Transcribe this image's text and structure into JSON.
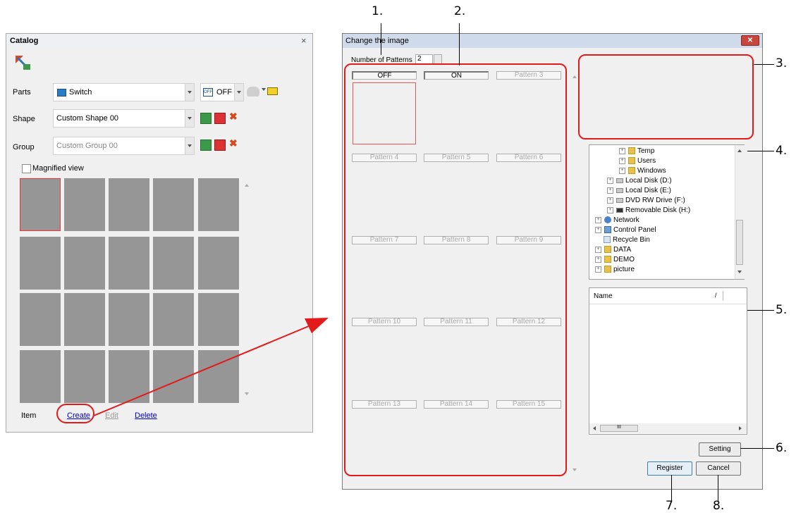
{
  "catalog": {
    "title": "Catalog",
    "close": "×",
    "parts_label": "Parts",
    "parts_value": "Switch",
    "state_value": "OFF",
    "state_badge": "OFF",
    "shape_label": "Shape",
    "shape_value": "Custom Shape 00",
    "group_label": "Group",
    "group_value": "Custom Group 00",
    "magnified_label": "Magnified view",
    "item_label": "Item",
    "create_link": "Create",
    "edit_link": "Edit",
    "delete_link": "Delete"
  },
  "dialog": {
    "title": "Change the image",
    "close": "✕",
    "num_patterns_label": "Number of Patterns",
    "num_patterns_value": "2",
    "patterns": [
      "OFF",
      "ON",
      "Pattern 3",
      "Pattern 4",
      "Pattern 5",
      "Pattern 6",
      "Pattern 7",
      "Pattern 8",
      "Pattern 9",
      "Pattern 10",
      "Pattern 11",
      "Pattern 12",
      "Pattern 13",
      "Pattern 14",
      "Pattern 15"
    ],
    "tree": [
      {
        "label": "Temp",
        "level": 3
      },
      {
        "label": "Users",
        "level": 3
      },
      {
        "label": "Windows",
        "level": 3
      },
      {
        "label": "Local Disk (D:)",
        "level": 2
      },
      {
        "label": "Local Disk (E:)",
        "level": 2
      },
      {
        "label": "DVD RW Drive (F:)",
        "level": 2
      },
      {
        "label": "Removable Disk (H:)",
        "level": 2
      },
      {
        "label": "Network",
        "level": 1
      },
      {
        "label": "Control Panel",
        "level": 1
      },
      {
        "label": "Recycle Bin",
        "level": 1
      },
      {
        "label": "DATA",
        "level": 1
      },
      {
        "label": "DEMO",
        "level": 1
      },
      {
        "label": "picture",
        "level": 1
      }
    ],
    "filelist_header": "Name",
    "filelist_scroll_thumb": "III",
    "setting_button": "Setting",
    "register_button": "Register",
    "cancel_button": "Cancel"
  },
  "callouts": {
    "c1": "1.",
    "c2": "2.",
    "c3": "3.",
    "c4": "4.",
    "c5": "5.",
    "c6": "6.",
    "c7": "7.",
    "c8": "8."
  },
  "colors": {
    "annotation_red": "#e21a1a",
    "cell_gray": "#969696",
    "dialog_close_red": "#c9463d"
  }
}
